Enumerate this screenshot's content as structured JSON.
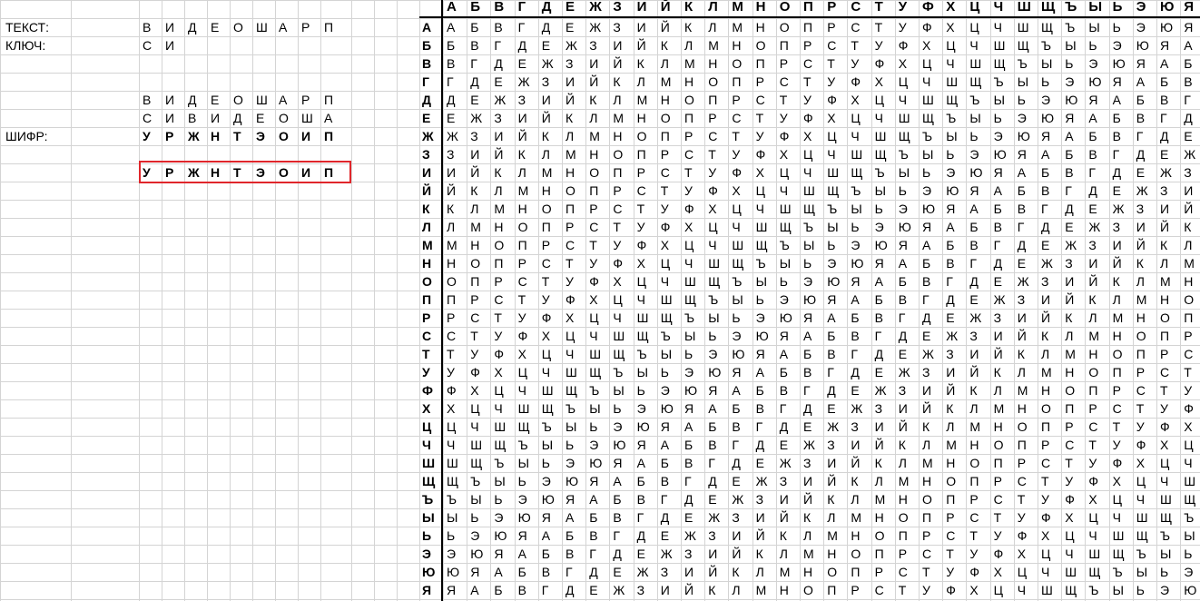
{
  "left_panel": {
    "label_text": "ТЕКСТ:",
    "label_key": "КЛЮЧ:",
    "label_cipher": "ШИФР:",
    "text_letters": [
      "В",
      "И",
      "Д",
      "Е",
      "О",
      "Ш",
      "А",
      "Р",
      "П"
    ],
    "key_letters": [
      "С",
      "И"
    ],
    "rows_aligned": {
      "text": [
        "В",
        "И",
        "Д",
        "Е",
        "О",
        "Ш",
        "А",
        "Р",
        "П"
      ],
      "key_repeated": [
        "С",
        "И",
        "В",
        "И",
        "Д",
        "Е",
        "О",
        "Ш",
        "А"
      ],
      "cipher": [
        "У",
        "Р",
        "Ж",
        "Н",
        "Т",
        "Э",
        "О",
        "И",
        "П"
      ]
    },
    "result": [
      "У",
      "Р",
      "Ж",
      "Н",
      "Т",
      "Э",
      "О",
      "И",
      "П"
    ]
  },
  "table": {
    "alphabet": [
      "А",
      "Б",
      "В",
      "Г",
      "Д",
      "Е",
      "Ж",
      "З",
      "И",
      "Й",
      "К",
      "Л",
      "М",
      "Н",
      "О",
      "П",
      "Р",
      "С",
      "Т",
      "У",
      "Ф",
      "Х",
      "Ц",
      "Ч",
      "Ш",
      "Щ",
      "Ъ",
      "Ы",
      "Ь",
      "Э",
      "Ю",
      "Я"
    ]
  },
  "colors": {
    "gridline": "#d4d4d4",
    "highlight_border": "#e0262b",
    "thick_border": "#000000"
  }
}
